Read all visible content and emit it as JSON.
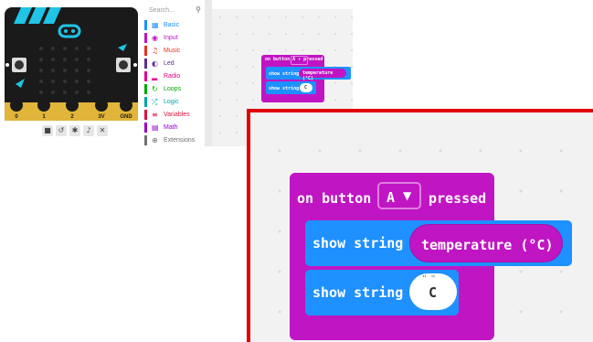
{
  "simulator": {
    "pins": [
      "0",
      "1",
      "2",
      "3V",
      "GND"
    ],
    "button_a": "A",
    "button_b": "B",
    "controls": [
      "■",
      "↺",
      "✱",
      "♪",
      "✕"
    ]
  },
  "toolbox": {
    "search_placeholder": "Search...",
    "search_icon": "search-icon",
    "categories": [
      {
        "label": "Basic",
        "icon": "grid-icon",
        "glyph": "▦",
        "color": "#1e90ff"
      },
      {
        "label": "Input",
        "icon": "target-icon",
        "glyph": "◉",
        "color": "#c015c3"
      },
      {
        "label": "Music",
        "icon": "headphones-icon",
        "glyph": "♫",
        "color": "#e63022"
      },
      {
        "label": "Led",
        "icon": "toggle-icon",
        "glyph": "◐",
        "color": "#5c2d91"
      },
      {
        "label": "Radio",
        "icon": "signal-icon",
        "glyph": "▂",
        "color": "#e3008c"
      },
      {
        "label": "Loops",
        "icon": "loop-icon",
        "glyph": "↻",
        "color": "#00aa00"
      },
      {
        "label": "Logic",
        "icon": "shuffle-icon",
        "glyph": "⤮",
        "color": "#00a4a6"
      },
      {
        "label": "Variables",
        "icon": "list-icon",
        "glyph": "≡",
        "color": "#dc143c"
      },
      {
        "label": "Math",
        "icon": "calculator-icon",
        "glyph": "▤",
        "color": "#9400d3"
      },
      {
        "label": "Extensions",
        "icon": "plus-icon",
        "glyph": "⊕",
        "color": "#707070"
      }
    ]
  },
  "workspace": {
    "event_block": {
      "prefix": "on button",
      "button": "A",
      "suffix": "pressed"
    },
    "rows": [
      {
        "label": "show string",
        "value": "temperature (°C)"
      },
      {
        "label": "show string",
        "value": "C"
      }
    ]
  },
  "zoom": {
    "event_prefix": "on button",
    "event_button": "A",
    "event_caret": "▼",
    "event_suffix": "pressed",
    "row1_label": "show string",
    "row1_value": "temperature (°C)",
    "row2_label": "show string",
    "row2_value": "C",
    "row2_quote": "\" \""
  },
  "colors": {
    "input_block": "#c015c3",
    "basic_block": "#1e90ff",
    "highlight_border": "#e00000"
  }
}
